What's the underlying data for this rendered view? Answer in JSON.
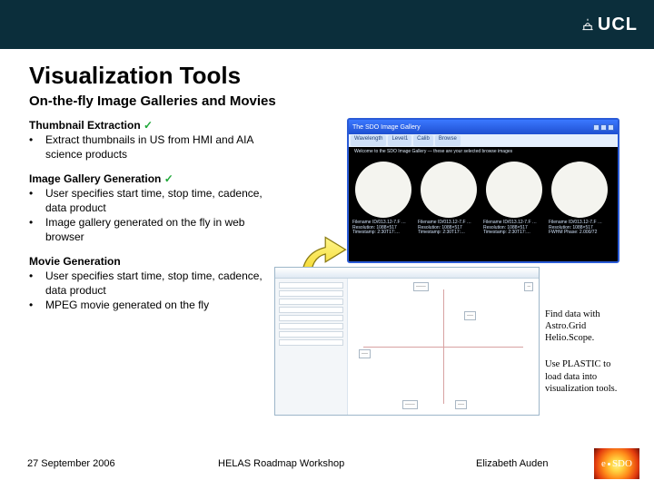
{
  "header": {
    "logo_text": "UCL"
  },
  "title": "Visualization Tools",
  "subtitle": "On-the-fly Image Galleries and Movies",
  "sections": [
    {
      "heading": "Thumbnail Extraction",
      "has_check": true,
      "bullets": [
        "Extract thumbnails in US from HMI and AIA science products"
      ]
    },
    {
      "heading": "Image Gallery Generation",
      "has_check": true,
      "bullets": [
        "User specifies start time, stop time, cadence, data product",
        "Image gallery generated on the fly in web browser"
      ]
    },
    {
      "heading": "Movie Generation",
      "has_check": false,
      "bullets": [
        "User specifies start time, stop time, cadence, data product",
        "MPEG movie generated on the fly"
      ]
    }
  ],
  "gallery": {
    "window_title": "The SDO Image Gallery",
    "tabs": [
      "Wavelength",
      "Level1",
      "Calib",
      "Browse"
    ],
    "welcome": "Welcome to the SDO Image Gallery — these are your selected browse images",
    "thumbs": [
      {
        "line1": "Filename ID/013.12-7.F …",
        "line2": "Resolution: 1088×517",
        "line3": "Timestamp: 2:30T17:…"
      },
      {
        "line1": "Filename ID/013.12-7.F …",
        "line2": "Resolution: 1088×517",
        "line3": "Timestamp: 2:30T17:…"
      },
      {
        "line1": "Filename ID/013.12-7.F …",
        "line2": "Resolution: 1088×517",
        "line3": "Timestamp: 2:30T17:…"
      },
      {
        "line1": "Filename ID/013.12-7.F …",
        "line2": "Resolution: 1088×517",
        "line3": "FWHM Phase: 2.000/72"
      }
    ]
  },
  "right_captions": {
    "p1": "Find data with Astro.Grid Helio.Scope.",
    "p2": "Use PLASTIC to load data into visualization tools."
  },
  "footer": {
    "date": "27 September 2006",
    "venue": "HELAS Roadmap Workshop",
    "author": "Elizabeth Auden",
    "badge_prefix": "e",
    "badge_suffix": "SDO"
  }
}
